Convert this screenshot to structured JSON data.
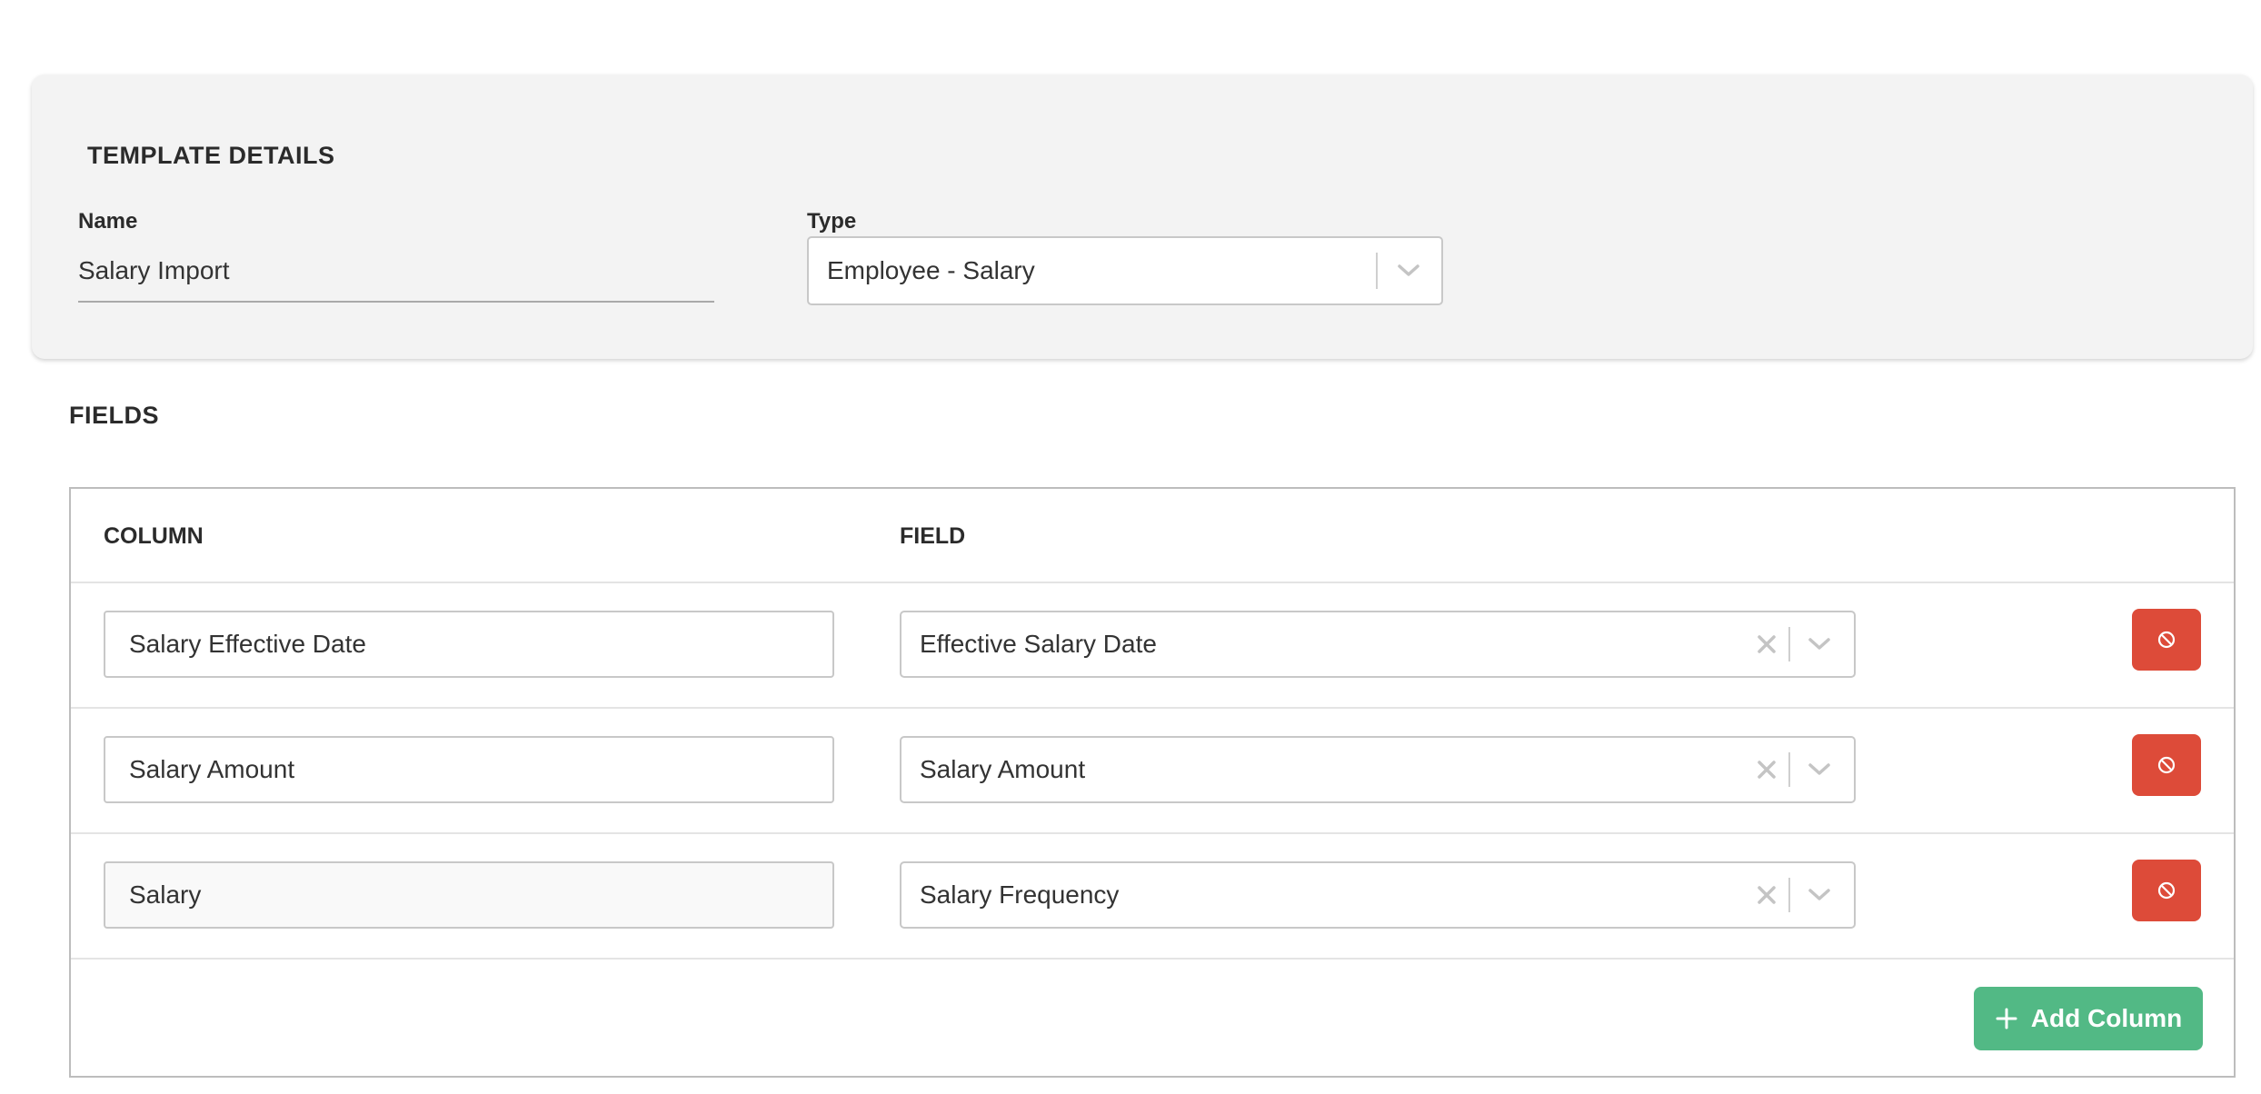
{
  "template_details": {
    "title": "TEMPLATE DETAILS",
    "name_label": "Name",
    "name_value": "Salary Import",
    "type_label": "Type",
    "type_value": "Employee - Salary"
  },
  "fields": {
    "title": "FIELDS",
    "headers": {
      "column": "COLUMN",
      "field": "FIELD"
    },
    "rows": [
      {
        "column": "Salary Effective Date",
        "field": "Effective Salary Date"
      },
      {
        "column": "Salary Amount",
        "field": "Salary Amount"
      },
      {
        "column": "Salary",
        "field": "Salary Frequency"
      }
    ],
    "add_button_label": "Add Column"
  },
  "colors": {
    "delete": "#dd4b39",
    "add": "#52b985",
    "card_bg": "#f3f3f3"
  },
  "icons": {
    "delete": "ban-icon",
    "add": "plus-icon",
    "dropdown": "chevron-down-icon",
    "clear": "clear-x-icon"
  }
}
